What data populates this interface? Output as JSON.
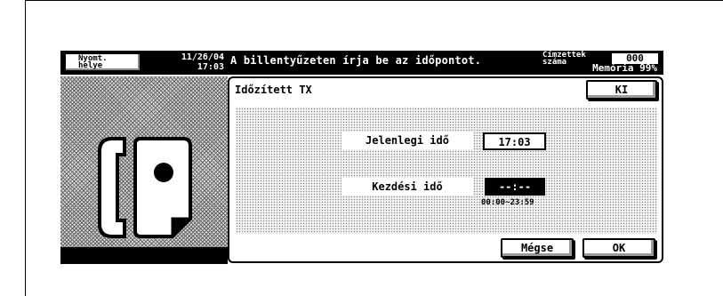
{
  "status": {
    "print_button_label_line1": "Nyomt.",
    "print_button_label_line2": "helye",
    "date": "11/26/04",
    "time": "17:03"
  },
  "message": "A billentyűzeten írja be az időpontot.",
  "recipients": {
    "label_line1": "Címzettek",
    "label_line2": "száma",
    "count": "000"
  },
  "memory": "Memória 99%",
  "dialog": {
    "title": "Időzített TX",
    "off_button": "KI",
    "current_time_label": "Jelenlegi idő",
    "current_time_value": "17:03",
    "start_time_label": "Kezdési idő",
    "start_time_value": "--:--",
    "range_hint": "00:00~23:59",
    "cancel_button": "Mégse",
    "ok_button": "OK"
  },
  "icon": "fax-phone-icon"
}
